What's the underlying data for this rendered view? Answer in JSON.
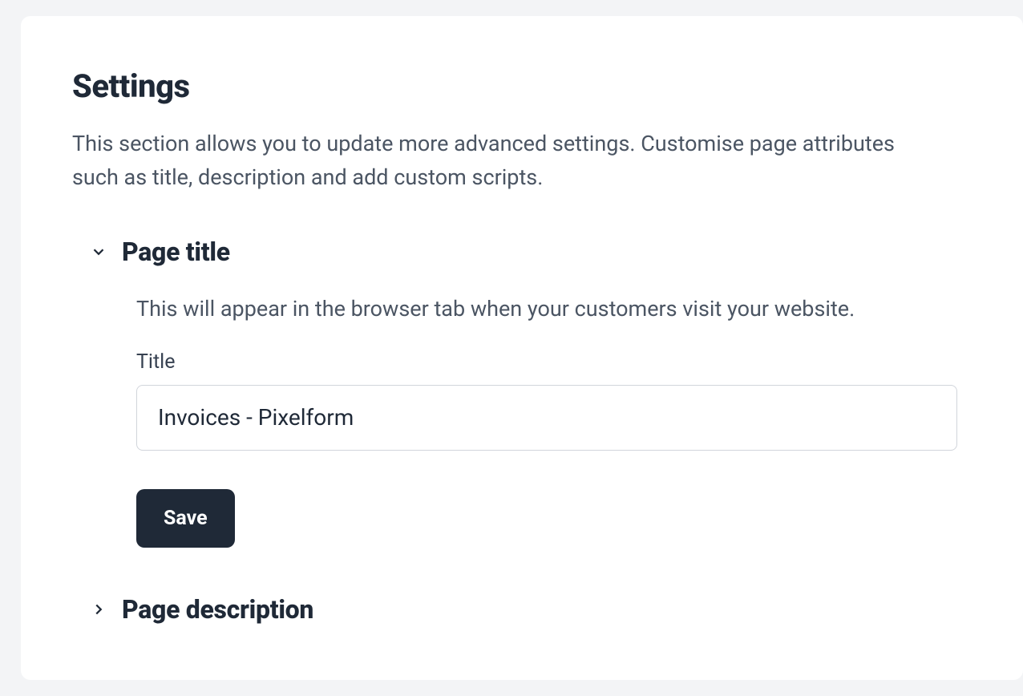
{
  "page": {
    "heading": "Settings",
    "intro": "This section allows you to update more advanced settings. Customise page attributes such as title, description and add custom scripts."
  },
  "sections": {
    "page_title": {
      "header": "Page title",
      "description": "This will appear in the browser tab when your customers visit your website.",
      "field_label": "Title",
      "field_value": "Invoices - Pixelform",
      "save_label": "Save"
    },
    "page_description": {
      "header": "Page description"
    }
  }
}
